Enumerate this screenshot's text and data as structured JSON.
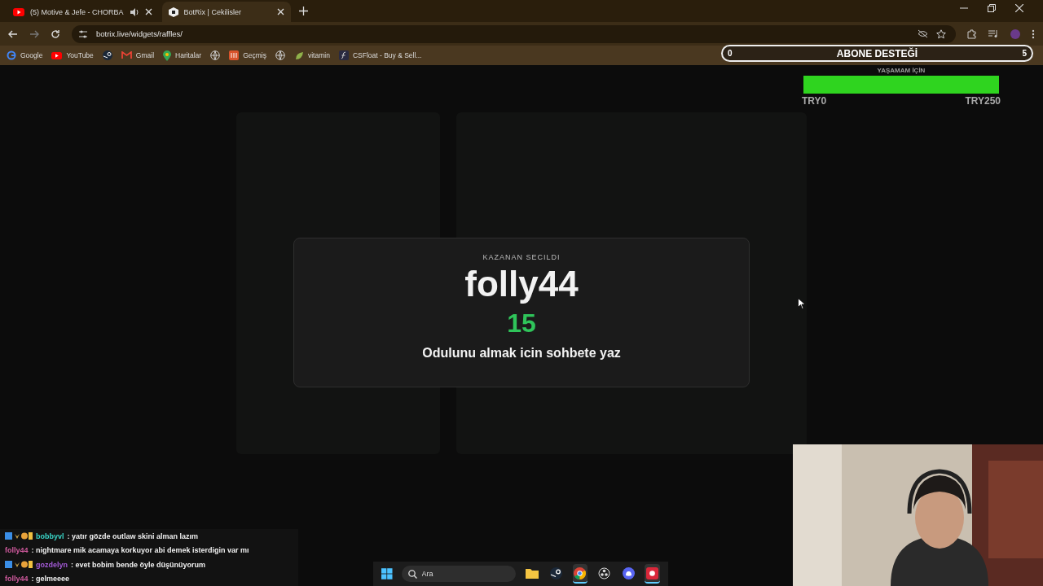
{
  "tabs": [
    {
      "title": "(5) Motive & Jefe - CHORBA",
      "kind": "video",
      "audio": true,
      "selected": false
    },
    {
      "title": "BotRix | Cekilisler",
      "kind": "site",
      "audio": false,
      "selected": true
    }
  ],
  "address": "botrix.live/widgets/raffles/",
  "bookmarks": [
    {
      "label": "Google",
      "kind": "google"
    },
    {
      "label": "YouTube",
      "kind": "video"
    },
    {
      "kind": "game"
    },
    {
      "label": "Gmail",
      "kind": "mail"
    },
    {
      "label": "Haritalar",
      "kind": "map"
    },
    {
      "kind": "globe"
    },
    {
      "label": "Geçmiş",
      "kind": "history"
    },
    {
      "kind": "globe"
    },
    {
      "label": "vitamin",
      "kind": "leaf"
    },
    {
      "label": "CSFloat - Buy & Sell...",
      "kind": "float"
    }
  ],
  "goal": {
    "start": "0",
    "title": "ABONE DESTEĞİ",
    "end": "5"
  },
  "donation": {
    "title": "YAŞAMAM İÇİN",
    "level": 1,
    "min": "TRY0",
    "max": "TRY250"
  },
  "winner": {
    "caption": "KAZANAN SECILDI",
    "name": "folly44",
    "count": "15",
    "message": "Odulunu almak icin sohbete yaz"
  },
  "chat": [
    {
      "user": "bobbyvl",
      "color": "#3ad6c8",
      "badges": true,
      "text": ": yatır gözde outlaw skini alman lazım"
    },
    {
      "user": "folly44",
      "color": "#d05a9e",
      "badges": false,
      "text": ": nightmare mik acamaya korkuyor abi demek isterdigin var mı"
    },
    {
      "user": "gozdelyn",
      "color": "#a35ad6",
      "badges": true,
      "text": ": evet bobim bende öyle düşünüyorum"
    },
    {
      "user": "folly44",
      "color": "#d05a9e",
      "badges": false,
      "text": ": gelmeeee"
    }
  ],
  "taskbar": {
    "search": {
      "placeholder": "Ara"
    },
    "apps": [
      {
        "kind": "folder",
        "active": false
      },
      {
        "kind": "game",
        "active": false
      },
      {
        "kind": "browser",
        "active": true
      },
      {
        "kind": "recorder",
        "active": false
      },
      {
        "kind": "chat",
        "active": false
      },
      {
        "kind": "record",
        "active": true
      }
    ]
  }
}
